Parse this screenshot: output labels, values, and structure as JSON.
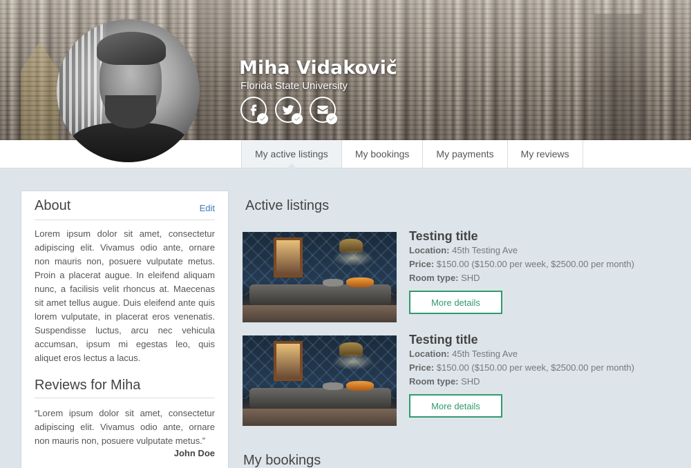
{
  "profile": {
    "name": "Miha Vidakovič",
    "university": "Florida State University",
    "socials": [
      {
        "icon": "facebook-icon",
        "verified": true
      },
      {
        "icon": "twitter-icon",
        "verified": true
      },
      {
        "icon": "email-icon",
        "verified": true
      }
    ]
  },
  "tabs": [
    {
      "label": "My active listings",
      "active": true
    },
    {
      "label": "My bookings",
      "active": false
    },
    {
      "label": "My payments",
      "active": false
    },
    {
      "label": "My reviews",
      "active": false
    }
  ],
  "about": {
    "title": "About",
    "edit_label": "Edit",
    "text": "Lorem ipsum dolor sit amet, consectetur adipiscing elit. Vivamus odio ante, ornare non mauris non, posuere vulputate metus. Proin a placerat augue. In eleifend aliquam nunc, a facilisis velit rhoncus at. Maecenas sit amet tellus augue. Duis eleifend ante quis lorem vulputate, in placerat eros venenatis. Suspendisse luctus, arcu nec vehicula accumsan, ipsum mi egestas leo, quis aliquet eros lectus a lacus."
  },
  "reviews": {
    "title": "Reviews for Miha",
    "items": [
      {
        "text": "“Lorem ipsum dolor sit amet, consectetur adipiscing elit. Vivamus odio ante, ornare non mauris non, posuere vulputate metus.”",
        "author": "John Doe"
      }
    ]
  },
  "active_listings": {
    "title": "Active listings",
    "items": [
      {
        "title": "Testing title",
        "location_label": "Location:",
        "location": "45th Testing Ave",
        "price_label": "Price:",
        "price": "$150.00 ($150.00 per week, $2500.00 per month)",
        "room_type_label": "Room type:",
        "room_type": "SHD",
        "button_label": "More details"
      },
      {
        "title": "Testing title",
        "location_label": "Location:",
        "location": "45th Testing Ave",
        "price_label": "Price:",
        "price": "$150.00 ($150.00 per week, $2500.00 per month)",
        "room_type_label": "Room type:",
        "room_type": "SHD",
        "button_label": "More details"
      }
    ]
  },
  "bookings": {
    "title": "My bookings"
  },
  "colors": {
    "accent_green": "#2f9a6b",
    "link_blue": "#3d7ab8",
    "page_background": "#dde5ea"
  }
}
